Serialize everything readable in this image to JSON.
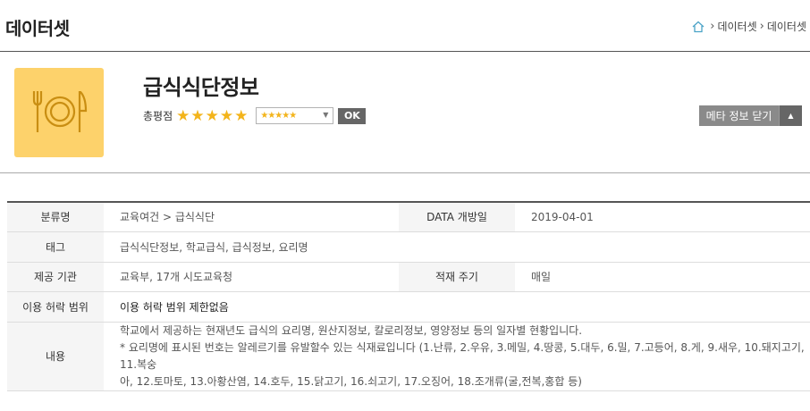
{
  "header": {
    "title": "데이터셋",
    "breadcrumb": [
      "데이터셋",
      "데이터셋"
    ]
  },
  "dataset": {
    "title": "급식식단정보",
    "icon": "restaurant-icon",
    "rating_label": "총평점",
    "rating_value": 5,
    "rating_max": 5,
    "rating_select_value": "★★★★★",
    "ok_label": "OK",
    "meta_toggle_label": "메타 정보 닫기"
  },
  "info": {
    "category_label": "분류명",
    "category_value": "교육여건 > 급식식단",
    "open_date_label": "DATA 개방일",
    "open_date_value": "2019-04-01",
    "tags_label": "태그",
    "tags_value": "급식식단정보, 학교급식, 급식정보, 요리명",
    "provider_label": "제공 기관",
    "provider_value": "교육부, 17개 시도교육청",
    "cycle_label": "적재 주기",
    "cycle_value": "매일",
    "license_label": "이용 허락 범위",
    "license_value": "이용 허락 범위 제한없음",
    "content_label": "내용",
    "content_lines": [
      "학교에서 제공하는 현재년도 급식의 요리명, 원산지정보, 칼로리정보, 영양정보 등의 일자별 현황입니다.",
      "* 요리명에 표시된 번호는 알레르기를 유발할수 있는 식재료입니다 (1.난류, 2.우유, 3.메밀, 4.땅콩, 5.대두, 6.밀, 7.고등어, 8.게, 9.새우, 10.돼지고기, 11.복숭",
      "아, 12.토마토, 13.아황산염, 14.호두, 15.닭고기, 16.쇠고기, 17.오징어, 18.조개류(굴,전복,홍합 등)"
    ]
  },
  "colors": {
    "accent_star": "#f3b41b",
    "thumb_bg": "#fdd26b",
    "button_dark": "#666666",
    "button_gray": "#8a8a8a"
  }
}
